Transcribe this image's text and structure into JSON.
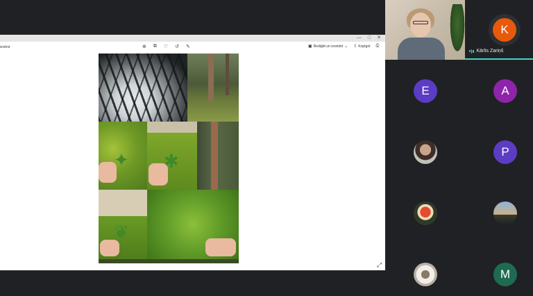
{
  "share": {
    "left_label": "izvērst",
    "window_controls": [
      "—",
      "□",
      "✕"
    ],
    "toolbar_icons": [
      "zoom-in-icon",
      "crop-icon",
      "heart-icon",
      "rotate-icon",
      "edit-icon"
    ],
    "edit_label": "Rediģēt un izveidot",
    "share_label": "Kopīgot",
    "more_label": "⋯"
  },
  "participants": {
    "speaker": {
      "initial": "K",
      "name": "Kārlis Zariņš",
      "color": "#e8590c"
    },
    "tiles": [
      {
        "initial": "E",
        "color": "#5b3cc4"
      },
      {
        "initial": "A",
        "color": "#8e24aa"
      },
      {
        "initial": "",
        "photo": true
      },
      {
        "initial": "P",
        "color": "#5b3cc4"
      },
      {
        "initial": "",
        "photo": true
      },
      {
        "initial": "",
        "photo": true
      },
      {
        "initial": "",
        "photo": true
      },
      {
        "initial": "M",
        "color": "#1e6b52"
      }
    ]
  }
}
